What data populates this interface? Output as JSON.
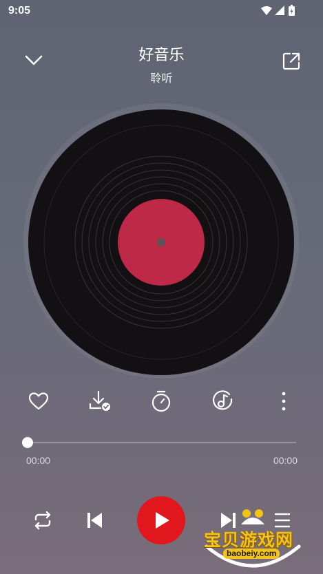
{
  "status": {
    "time": "9:05"
  },
  "header": {
    "title": "好音乐",
    "subtitle": "聆听"
  },
  "icons": {
    "back": "chevron-down-icon",
    "share": "external-link-icon",
    "favorite": "heart-icon",
    "download": "download-check-icon",
    "timer": "timer-icon",
    "effects": "music-effect-icon",
    "more": "more-vertical-icon",
    "repeat": "repeat-icon",
    "previous": "skip-previous-icon",
    "play": "play-icon",
    "next": "skip-next-icon",
    "playlist": "playlist-icon"
  },
  "player": {
    "elapsed": "00:00",
    "duration": "00:00",
    "progress": 0
  },
  "colors": {
    "accent": "#e2171d",
    "disc_label": "#bd2946",
    "disc": "#121012"
  },
  "watermark": {
    "text": "宝贝游戏网",
    "url": "baobeiy.com"
  }
}
